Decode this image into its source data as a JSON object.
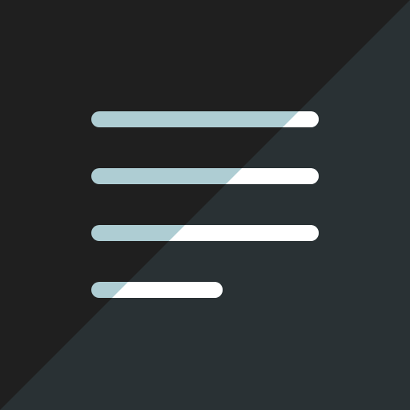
{
  "icon": {
    "name": "text-lines-icon",
    "colors": {
      "background_dark": "#1f1f1f",
      "background_diagonal": "#293134",
      "line_on_dark": "#aecdd3",
      "line_on_diagonal": "#ffffff"
    },
    "lines": [
      {
        "id": "line-1",
        "length": "full"
      },
      {
        "id": "line-2",
        "length": "full"
      },
      {
        "id": "line-3",
        "length": "full"
      },
      {
        "id": "line-4",
        "length": "short"
      }
    ]
  }
}
